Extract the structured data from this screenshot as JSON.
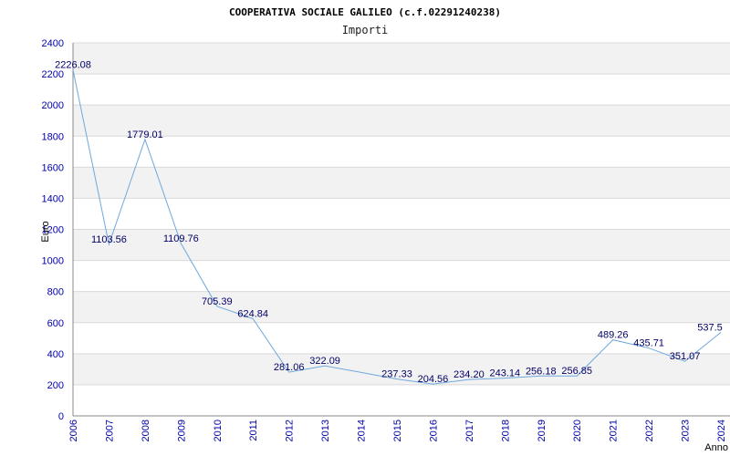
{
  "chart_data": {
    "type": "line",
    "title": "COOPERATIVA SOCIALE GALILEO (c.f.02291240238)",
    "subtitle": "Importi",
    "xlabel": "Anno",
    "ylabel": "Euro",
    "ylim": [
      0,
      2400
    ],
    "yticks": [
      0,
      200,
      400,
      600,
      800,
      1000,
      1200,
      1400,
      1600,
      1800,
      2000,
      2200,
      2400
    ],
    "grid": true,
    "x": [
      "2006",
      "2007",
      "2008",
      "2009",
      "2010",
      "2011",
      "2012",
      "2013",
      "2014",
      "2015",
      "2016",
      "2017",
      "2018",
      "2019",
      "2020",
      "2021",
      "2022",
      "2023",
      "2024"
    ],
    "series": [
      {
        "values": [
          2226.08,
          1103.56,
          1779.01,
          1109.76,
          705.39,
          624.84,
          281.06,
          322.09,
          null,
          237.33,
          204.56,
          234.2,
          243.14,
          256.18,
          256.85,
          489.26,
          435.71,
          351.07,
          537.5
        ],
        "labels": [
          "2226.08",
          "1103.56",
          "1779.01",
          "1109.76",
          "705.39",
          "624.84",
          "281.06",
          "322.09",
          "",
          "237.33",
          "204.56",
          "234.20",
          "243.14",
          "256.18",
          "256.85",
          "489.26",
          "435.71",
          "351.07",
          "537.5"
        ]
      }
    ],
    "colors": {
      "line": "#6fa8dc",
      "band": "#f2f2f2",
      "grid": "#d9d9d9",
      "ticks": "#0000aa"
    }
  }
}
